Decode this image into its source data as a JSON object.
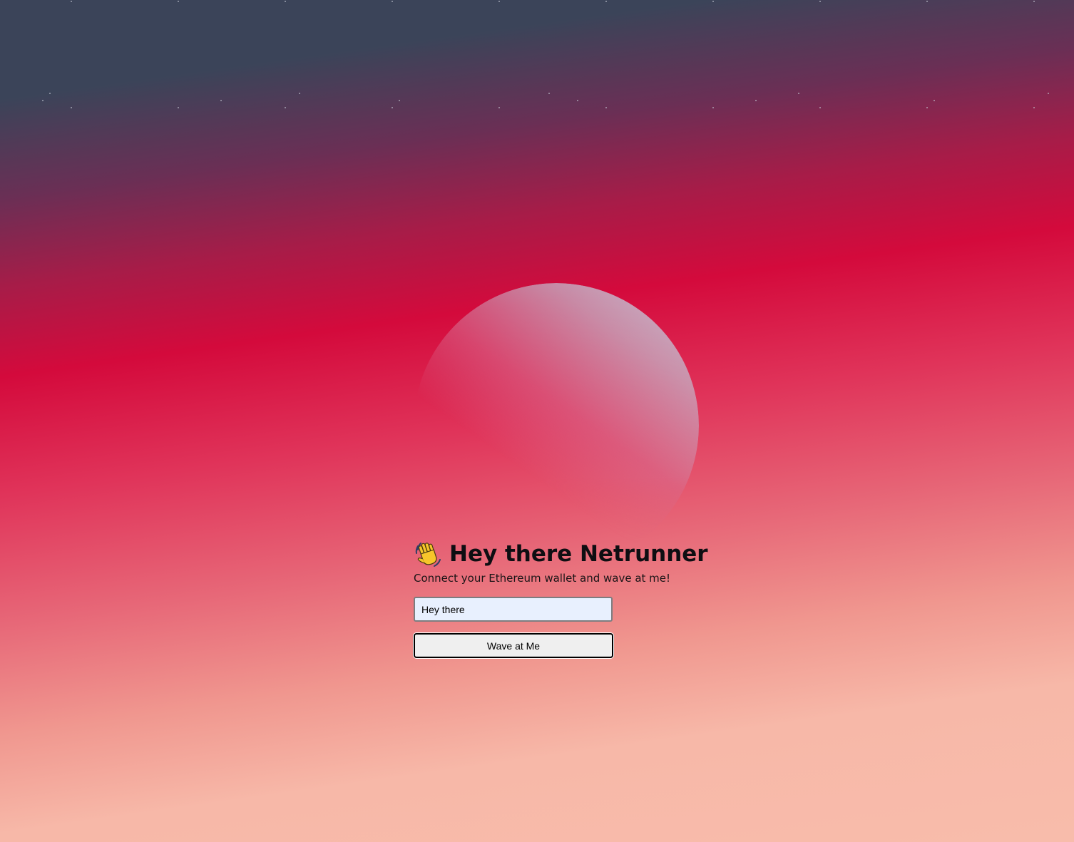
{
  "header": {
    "wave_icon": "waving-hand-icon",
    "title": "Hey there Netrunner",
    "subtitle": "Connect your Ethereum wallet and wave at me!"
  },
  "form": {
    "message_value": "Hey there",
    "button_label": "Wave at Me"
  },
  "theme": {
    "sky_top": "#3b4459",
    "horizon_red": "#d40a3c",
    "sand_pink": "#f8bcab",
    "input_background": "#e8f0fe",
    "button_background": "#efefef"
  }
}
